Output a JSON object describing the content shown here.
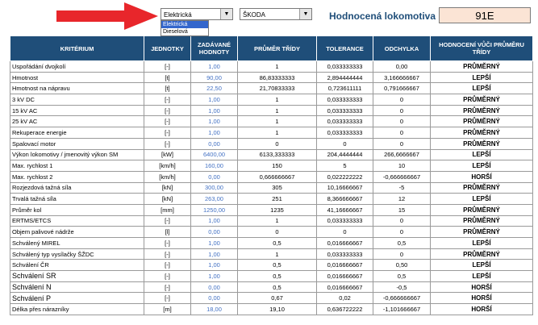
{
  "controls": {
    "type_select": "Elektrická",
    "type_options": [
      "Elektrická",
      "Dieselová"
    ],
    "maker_select": "ŠKODA",
    "combo_arrow": "▼"
  },
  "locomotive": {
    "label": "Hodnocená lokomotiva",
    "value": "91E"
  },
  "table": {
    "headers": [
      "KRITÉRIUM",
      "JEDNOTKY",
      "ZADÁVANÉ HODNOTY",
      "PRŮMĚR TŘÍDY",
      "TOLERANCE",
      "ODCHYLKA",
      "HODNOCENÍ VŮČI PRŮMĚRU TŘÍDY"
    ],
    "rows": [
      [
        "Uspořádání dvojkolí",
        "[-]",
        "1,00",
        "1",
        "0,033333333",
        "0,00",
        "PRŮMĚRNÝ"
      ],
      [
        "Hmotnost",
        "[t]",
        "90,00",
        "86,83333333",
        "2,894444444",
        "3,166666667",
        "LEPŠÍ"
      ],
      [
        "Hmotnost na nápravu",
        "[t]",
        "22,50",
        "21,70833333",
        "0,723611111",
        "0,791666667",
        "LEPŠÍ"
      ],
      [
        "3 kV DC",
        "[-]",
        "1,00",
        "1",
        "0,033333333",
        "0",
        "PRŮMĚRNÝ"
      ],
      [
        "15 kV AC",
        "[-]",
        "1,00",
        "1",
        "0,033333333",
        "0",
        "PRŮMĚRNÝ"
      ],
      [
        "25 kV AC",
        "[-]",
        "1,00",
        "1",
        "0,033333333",
        "0",
        "PRŮMĚRNÝ"
      ],
      [
        "Rekuperace energie",
        "[-]",
        "1,00",
        "1",
        "0,033333333",
        "0",
        "PRŮMĚRNÝ"
      ],
      [
        "Spalovací motor",
        "[-]",
        "0,00",
        "0",
        "0",
        "0",
        "PRŮMĚRNÝ"
      ],
      [
        "Výkon lokomotivy / jmenovitý výkon SM",
        "[kW]",
        "6400,00",
        "6133,333333",
        "204,4444444",
        "266,6666667",
        "LEPŠÍ"
      ],
      [
        "Max. rychlost 1",
        "[km/h]",
        "160,00",
        "150",
        "5",
        "10",
        "LEPŠÍ"
      ],
      [
        "Max. rychlost 2",
        "[km/h]",
        "0,00",
        "0,666666667",
        "0,022222222",
        "-0,666666667",
        "HORŠÍ"
      ],
      [
        "Rozjezdová tažná síla",
        "[kN]",
        "300,00",
        "305",
        "10,16666667",
        "-5",
        "PRŮMĚRNÝ"
      ],
      [
        "Trvalá tažná síla",
        "[kN]",
        "263,00",
        "251",
        "8,366666667",
        "12",
        "LEPŠÍ"
      ],
      [
        "Průměr kol",
        "[mm]",
        "1250,00",
        "1235",
        "41,16666667",
        "15",
        "PRŮMĚRNÝ"
      ],
      [
        "ERTMS/ETCS",
        "[-]",
        "1,00",
        "1",
        "0,033333333",
        "0",
        "PRŮMĚRNÝ"
      ],
      [
        "Objem palivové nádrže",
        "[l]",
        "0,00",
        "0",
        "0",
        "0",
        "PRŮMĚRNÝ"
      ],
      [
        "Schválený MIREL",
        "[-]",
        "1,00",
        "0,5",
        "0,016666667",
        "0,5",
        "LEPŠÍ"
      ],
      [
        "Schválený typ vysílačky ŠŽDC",
        "[-]",
        "1,00",
        "1",
        "0,033333333",
        "0",
        "PRŮMĚRNÝ"
      ],
      [
        "Schválení ČR",
        "[-]",
        "1,00",
        "0,5",
        "0,016666667",
        "0,50",
        "LEPŠÍ"
      ],
      [
        "Schválení SR",
        "[-]",
        "1,00",
        "0,5",
        "0,016666667",
        "0,5",
        "LEPŠÍ"
      ],
      [
        "Schválení N",
        "[-]",
        "0,00",
        "0,5",
        "0,016666667",
        "-0,5",
        "HORŠÍ"
      ],
      [
        "Schválení P",
        "[-]",
        "0,00",
        "0,67",
        "0,02",
        "-0,666666667",
        "HORŠÍ"
      ],
      [
        "Délka přes nárazníky",
        "[m]",
        "18,00",
        "19,10",
        "0,636722222",
        "-1,101666667",
        "HORŠÍ"
      ]
    ]
  }
}
